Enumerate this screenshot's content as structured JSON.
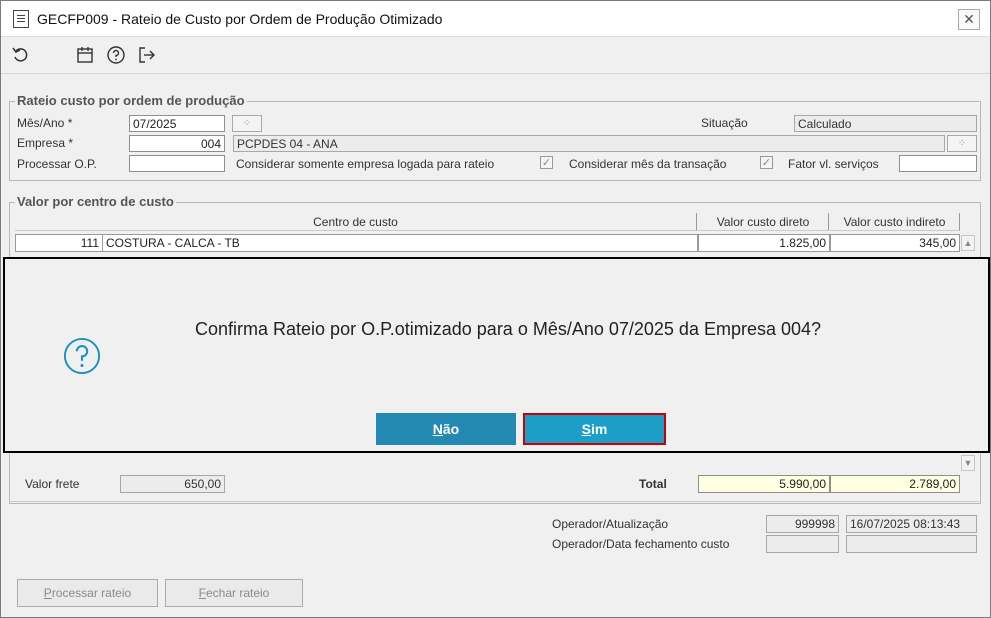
{
  "window": {
    "title": "GECFP009 - Rateio de Custo por Ordem de Produção Otimizado",
    "close_glyph": "✕"
  },
  "toolbar": {
    "icons": [
      "undo-icon",
      "calendar-icon",
      "help-icon",
      "exit-icon"
    ]
  },
  "rateio_group": {
    "legend": "Rateio custo por ordem de produção",
    "mes_ano_label": "Mês/Ano *",
    "mes_ano_value": "07/2025",
    "empresa_label": "Empresa *",
    "empresa_code": "004",
    "empresa_name": "PCPDES 04 - ANA",
    "processar_op_label": "Processar O.P.",
    "processar_op_value": "",
    "situacao_label": "Situação",
    "situacao_value": "Calculado",
    "considerar_empresa_label": "Considerar somente empresa logada para rateio",
    "considerar_mes_label": "Considerar mês da transação",
    "fator_label": "Fator vl. serviços",
    "fator_value": "",
    "check_glyph": "✓",
    "lookup_glyph": "⁘"
  },
  "centro_group": {
    "legend": "Valor por centro de custo",
    "columns": [
      "Centro de custo",
      "Valor custo direto",
      "Valor custo indireto"
    ],
    "rows": [
      {
        "code": "111",
        "name": "COSTURA - CALCA - TB",
        "direto": "1.825,00",
        "indireto": "345,00"
      }
    ],
    "scroll_up": "▲",
    "scroll_down": "▼"
  },
  "dialog": {
    "message": "Confirma Rateio por O.P.otimizado para o Mês/Ano 07/2025 da Empresa 004?",
    "nao_mnemonic": "N",
    "nao_rest": "ão",
    "sim_mnemonic": "S",
    "sim_rest": "im"
  },
  "totals": {
    "frete_label": "Valor frete",
    "frete_value": "650,00",
    "total_label": "Total",
    "total_direto": "5.990,00",
    "total_indireto": "2.789,00"
  },
  "operator": {
    "atualizacao_label": "Operador/Atualização",
    "atualizacao_operator": "999998",
    "atualizacao_datetime": "16/07/2025 08:13:43",
    "fechamento_label": "Operador/Data fechamento custo",
    "fechamento_operator": "",
    "fechamento_date": ""
  },
  "buttons": {
    "processar_mnemonic": "P",
    "processar_rest": "rocessar rateio",
    "fechar_mnemonic": "F",
    "fechar_rest": "echar rateio"
  },
  "colors": {
    "dialog_button": "#1b9fc9",
    "focus_border": "#cc0000",
    "total_highlight": "#ffffe1"
  }
}
